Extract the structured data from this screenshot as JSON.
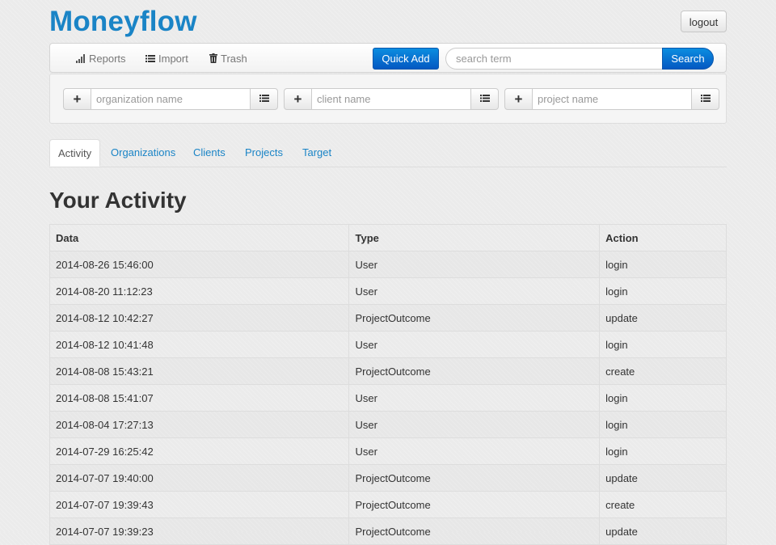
{
  "header": {
    "brand": "Moneyflow",
    "logout_label": "logout"
  },
  "navbar": {
    "items": [
      {
        "label": "Reports",
        "icon": "bar-chart-icon"
      },
      {
        "label": "Import",
        "icon": "list-icon"
      },
      {
        "label": "Trash",
        "icon": "trash-icon"
      }
    ],
    "quick_add_label": "Quick Add",
    "search_placeholder": "search term",
    "search_label": "Search"
  },
  "quick_add": {
    "fields": [
      {
        "placeholder": "organization name"
      },
      {
        "placeholder": "client name"
      },
      {
        "placeholder": "project name"
      }
    ]
  },
  "tabs": [
    {
      "label": "Activity",
      "active": true
    },
    {
      "label": "Organizations"
    },
    {
      "label": "Clients"
    },
    {
      "label": "Projects"
    },
    {
      "label": "Target"
    }
  ],
  "main": {
    "title": "Your Activity",
    "columns": [
      "Data",
      "Type",
      "Action"
    ],
    "rows": [
      [
        "2014-08-26 15:46:00",
        "User",
        "login"
      ],
      [
        "2014-08-20 11:12:23",
        "User",
        "login"
      ],
      [
        "2014-08-12 10:42:27",
        "ProjectOutcome",
        "update"
      ],
      [
        "2014-08-12 10:41:48",
        "User",
        "login"
      ],
      [
        "2014-08-08 15:43:21",
        "ProjectOutcome",
        "create"
      ],
      [
        "2014-08-08 15:41:07",
        "User",
        "login"
      ],
      [
        "2014-08-04 17:27:13",
        "User",
        "login"
      ],
      [
        "2014-07-29 16:25:42",
        "User",
        "login"
      ],
      [
        "2014-07-07 19:40:00",
        "ProjectOutcome",
        "update"
      ],
      [
        "2014-07-07 19:39:43",
        "ProjectOutcome",
        "create"
      ],
      [
        "2014-07-07 19:39:23",
        "ProjectOutcome",
        "update"
      ]
    ]
  },
  "colors": {
    "brand": "#1a84c6",
    "primary_button": "#0a72d6",
    "link": "#1a84c6"
  }
}
